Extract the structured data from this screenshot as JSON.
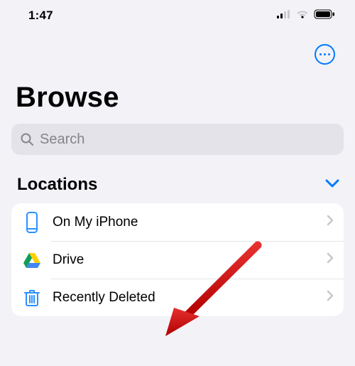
{
  "status": {
    "time": "1:47"
  },
  "toolbar": {
    "more_label": "more"
  },
  "title": "Browse",
  "search": {
    "placeholder": "Search"
  },
  "section": {
    "title": "Locations",
    "expanded": true,
    "items": [
      {
        "name": "on-my-iphone",
        "label": "On My iPhone",
        "icon": "iphone-icon"
      },
      {
        "name": "drive",
        "label": "Drive",
        "icon": "google-drive-icon"
      },
      {
        "name": "recently-deleted",
        "label": "Recently Deleted",
        "icon": "trash-icon"
      }
    ]
  },
  "annotation": {
    "arrow_points_to": "recently-deleted"
  }
}
